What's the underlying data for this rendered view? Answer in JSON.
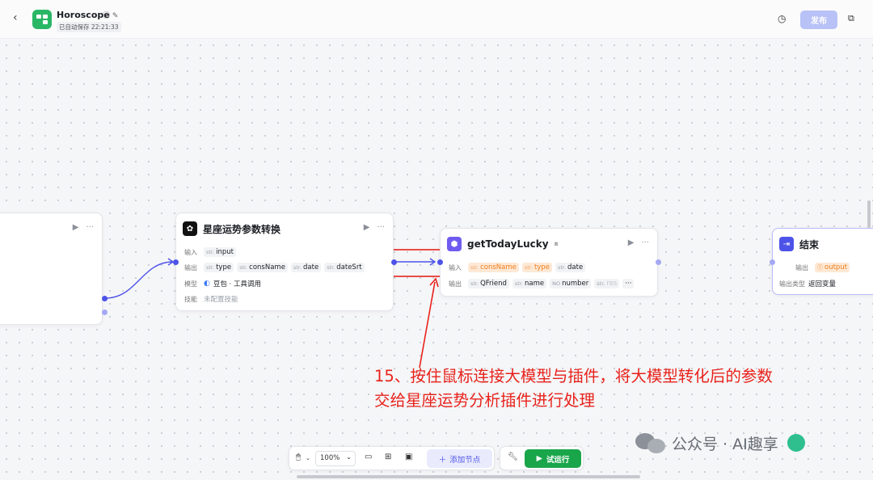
{
  "header": {
    "back_icon": "chevron-left-icon",
    "title": "Horoscope",
    "autosave": "已自动保存 22:21:33",
    "publish_label": "发布"
  },
  "nodes": {
    "left_partial": {
      "run_icon": "▶",
      "more_icon": "···"
    },
    "param_convert": {
      "title": "星座运势参数转换",
      "input_label": "输入",
      "inputs": [
        {
          "type": "str.",
          "name": "input"
        }
      ],
      "output_label": "输出",
      "outputs": [
        {
          "type": "str.",
          "name": "type"
        },
        {
          "type": "str.",
          "name": "consName"
        },
        {
          "type": "str.",
          "name": "date"
        },
        {
          "type": "str.",
          "name": "dateSrt"
        }
      ],
      "model_label": "模型",
      "model_value": "豆包 · 工具调用",
      "skill_label": "技能",
      "skill_value": "未配置技能"
    },
    "get_lucky": {
      "title": "getTodayLucky",
      "input_label": "输入",
      "inputs": [
        {
          "type": "str.",
          "name": "consName"
        },
        {
          "type": "str.",
          "name": "type"
        },
        {
          "type": "str.",
          "name": "date"
        }
      ],
      "output_label": "输出",
      "outputs": [
        {
          "type": "str.",
          "name": "QFriend"
        },
        {
          "type": "str.",
          "name": "name"
        },
        {
          "type": "NO",
          "name": "number"
        },
        {
          "type": "str.",
          "name": "res"
        }
      ],
      "overflow": "···"
    },
    "end": {
      "title": "结束",
      "output_label": "输出",
      "output_value": "output",
      "output_type_label": "输出类型",
      "output_type_value": "返回变量"
    }
  },
  "toolbar": {
    "zoom": "100%",
    "add_node_label": "添加节点",
    "run_label": "试运行"
  },
  "annotation": {
    "number": "15",
    "text_line1": "15、按住鼠标连接大模型与插件，将大模型转化后的参数",
    "text_line2": "交给星座运势分析插件进行处理"
  },
  "watermark": "公众号 · AI趣享",
  "colors": {
    "accent": "#4d53e8",
    "run_green": "#19a64b",
    "publish_disabled": "#b9c2f6",
    "annotation_red": "#e8221b",
    "orange_tag": "#f07d1a"
  }
}
